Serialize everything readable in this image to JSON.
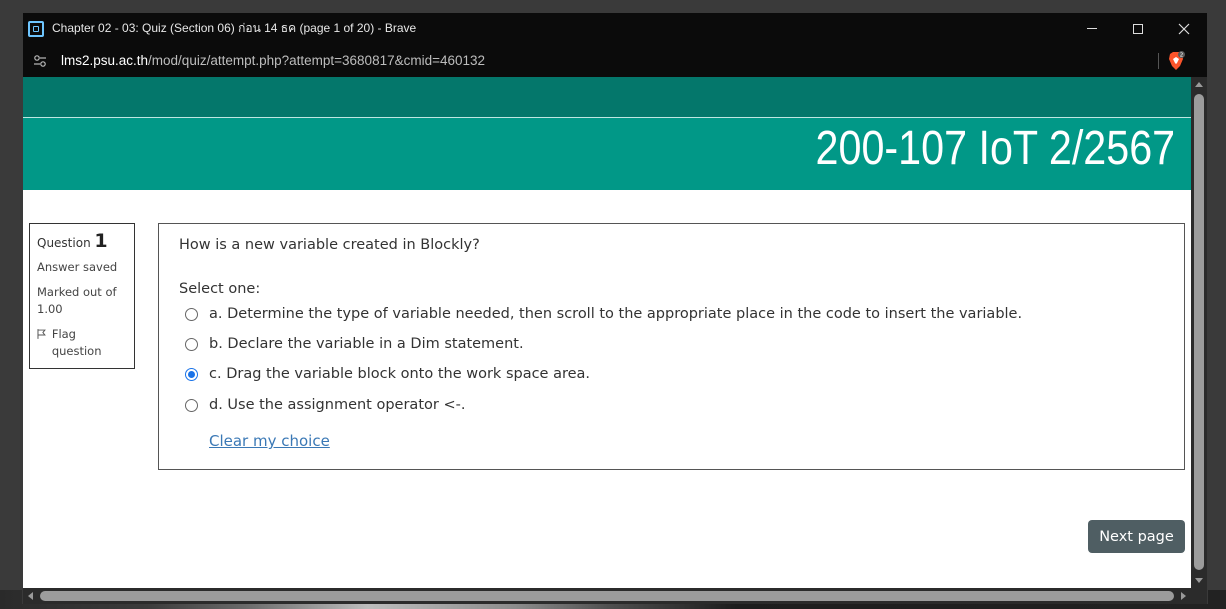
{
  "window": {
    "title": "Chapter 02 - 03: Quiz (Section 06) ก่อน 14 ธค (page 1 of 20) - Brave"
  },
  "address": {
    "host": "lms2.psu.ac.th",
    "path": "/mod/quiz/attempt.php?attempt=3680817&cmid=460132",
    "brave_badge_count": "2"
  },
  "page": {
    "course_title": "200-107 IoT 2/2567"
  },
  "question_info": {
    "label": "Question",
    "number": "1",
    "state": "Answer saved",
    "grade": "Marked out of 1.00",
    "flag_label": "Flag question"
  },
  "question": {
    "text": "How is a new variable created in Blockly?",
    "prompt": "Select one:",
    "answers": [
      {
        "label": "a. Determine the type of variable needed, then scroll to the appropriate place in the code to insert the variable.",
        "selected": false
      },
      {
        "label": "b. Declare the variable in a Dim statement.",
        "selected": false
      },
      {
        "label": "c. Drag the variable block onto the work space area.",
        "selected": true
      },
      {
        "label": "d. Use the assignment operator <-.",
        "selected": false
      }
    ],
    "clear_label": "Clear my choice"
  },
  "nav": {
    "next_label": "Next page"
  },
  "colors": {
    "banner_dark": "#04776b",
    "banner": "#019887",
    "radio_selected": "#1a73e8",
    "next_button": "#4f5e63",
    "link": "#3a78b5"
  }
}
